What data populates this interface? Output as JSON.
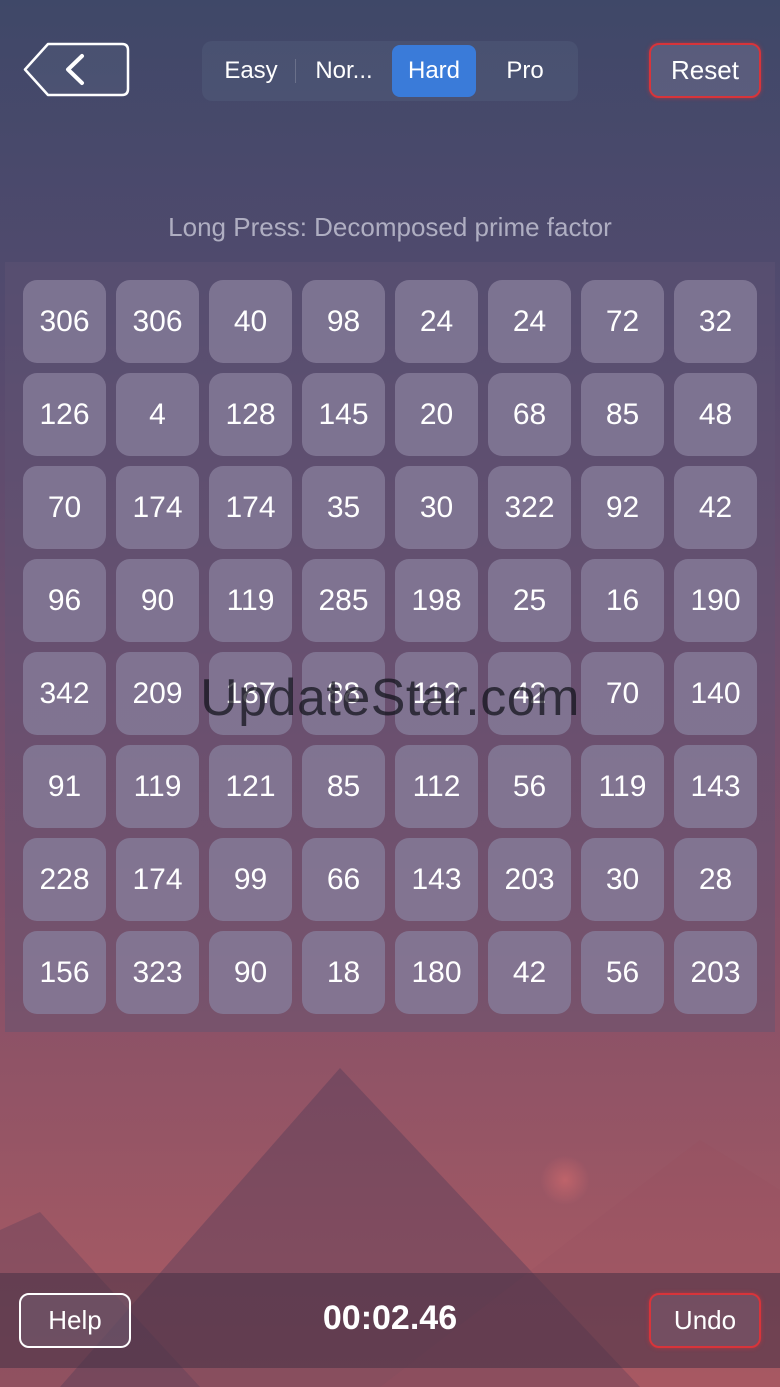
{
  "header": {
    "back_icon": "chevron-left-icon",
    "difficulty_tabs": [
      {
        "label": "Easy",
        "active": false
      },
      {
        "label": "Nor...",
        "active": false
      },
      {
        "label": "Hard",
        "active": true
      },
      {
        "label": "Pro",
        "active": false
      }
    ],
    "reset_label": "Reset"
  },
  "hint": "Long Press: Decomposed prime factor",
  "board": {
    "rows": [
      [
        "306",
        "306",
        "40",
        "98",
        "24",
        "24",
        "72",
        "32"
      ],
      [
        "126",
        "4",
        "128",
        "145",
        "20",
        "68",
        "85",
        "48"
      ],
      [
        "70",
        "174",
        "174",
        "35",
        "30",
        "322",
        "92",
        "42"
      ],
      [
        "96",
        "90",
        "119",
        "285",
        "198",
        "25",
        "16",
        "190"
      ],
      [
        "342",
        "209",
        "187",
        "88",
        "112",
        "42",
        "70",
        "140"
      ],
      [
        "91",
        "119",
        "121",
        "85",
        "112",
        "56",
        "119",
        "143"
      ],
      [
        "228",
        "174",
        "99",
        "66",
        "143",
        "203",
        "30",
        "28"
      ],
      [
        "156",
        "323",
        "90",
        "18",
        "180",
        "42",
        "56",
        "203"
      ]
    ]
  },
  "watermark": "UpdateStar.com",
  "footer": {
    "help_label": "Help",
    "timer": "00:02.46",
    "undo_label": "Undo"
  },
  "colors": {
    "active_tab": "#3a7bd9",
    "accent_border": "#d8343a"
  }
}
